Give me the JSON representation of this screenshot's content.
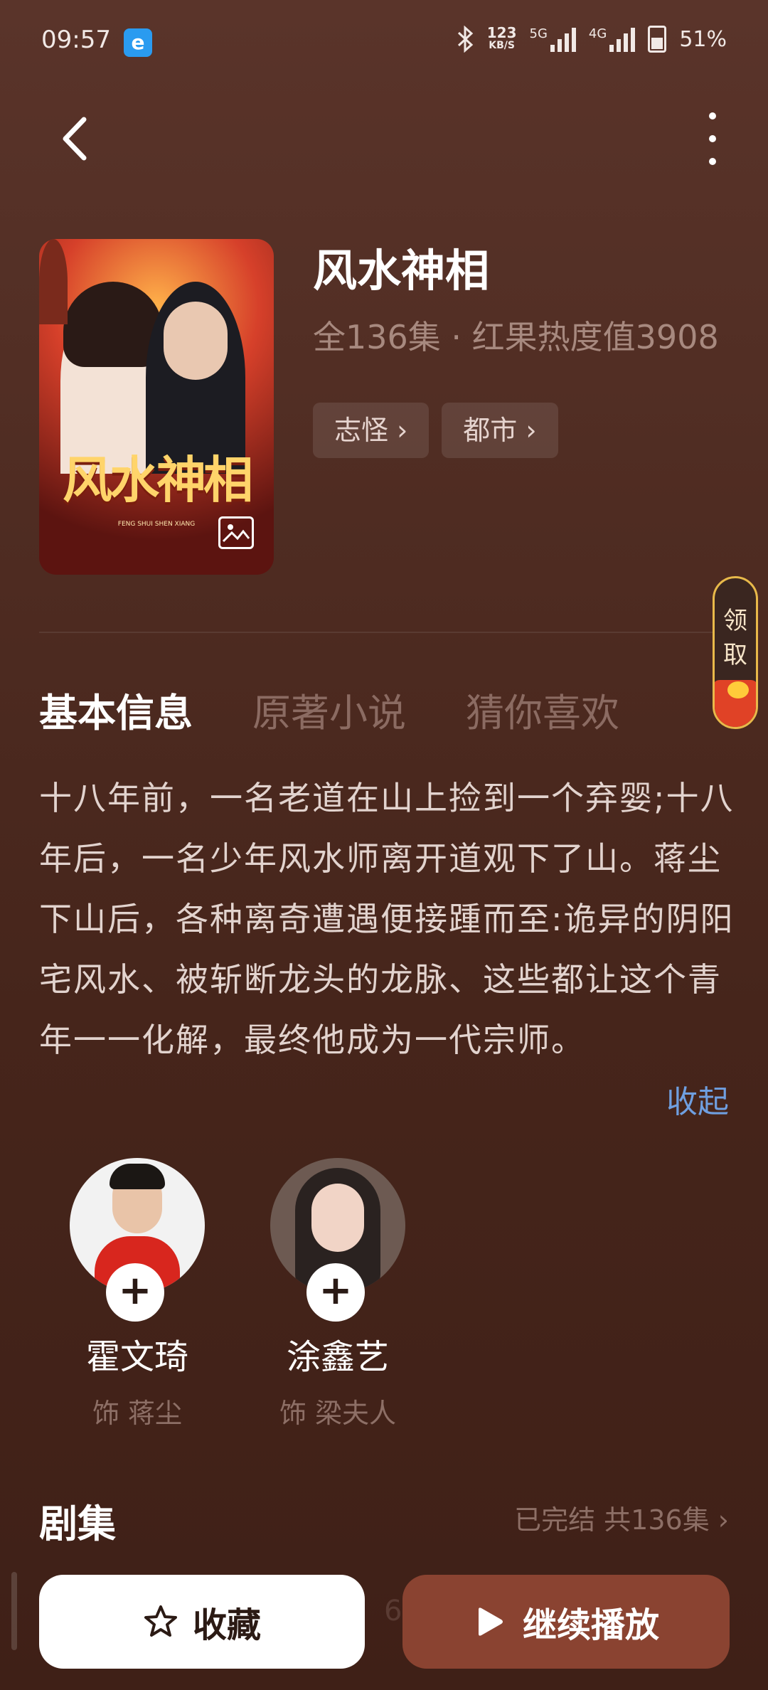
{
  "status": {
    "time": "09:57",
    "app_badge": "e",
    "net_speed_top": "123",
    "net_speed_bottom": "KB/S",
    "net_5g": "5G",
    "net_4g": "4G",
    "battery": "51%"
  },
  "drama": {
    "title": "风水神相",
    "meta": "全136集 · 红果热度值3908",
    "tags": [
      "志怪",
      "都市"
    ],
    "poster_title": "风水神相",
    "poster_subtitle": "FENG SHUI SHEN XIANG"
  },
  "reward": {
    "label_line1": "领",
    "label_line2": "取"
  },
  "tabs": [
    {
      "label": "基本信息",
      "active": true
    },
    {
      "label": "原著小说",
      "active": false
    },
    {
      "label": "猜你喜欢",
      "active": false
    }
  ],
  "description": "十八年前，一名老道在山上捡到一个弃婴;十八年后，一名少年风水师离开道观下了山。蒋尘下山后，各种离奇遭遇便接踵而至:诡异的阴阳宅风水、被斩断龙头的龙脉、这些都让这个青年一一化解，最终他成为一代宗师。",
  "collapse_label": "收起",
  "cast": [
    {
      "name": "霍文琦",
      "role": "饰 蒋尘"
    },
    {
      "name": "涂鑫艺",
      "role": "饰 梁夫人"
    }
  ],
  "episodes": {
    "title": "剧集",
    "status": "已完结 共136集"
  },
  "actions": {
    "collect_label": "收藏",
    "play_label": "继续播放",
    "ghost_number": "6"
  },
  "colors": {
    "accent_link": "#6f9fe0",
    "play_button": "#8a4331"
  }
}
